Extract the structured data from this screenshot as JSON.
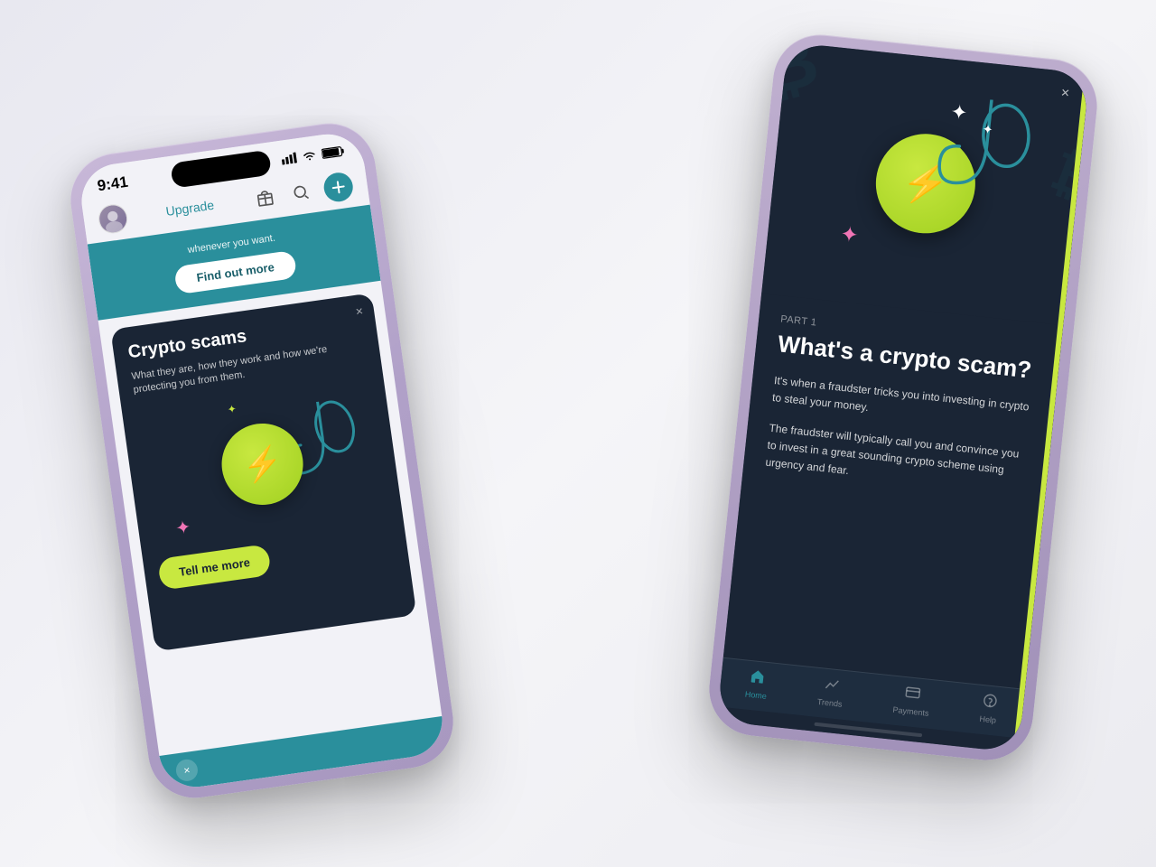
{
  "scene": {
    "background": "#f0f0f5"
  },
  "phone_left": {
    "status_bar": {
      "time": "9:41",
      "signal": "●●●●",
      "wifi": "WiFi",
      "battery": "🔋"
    },
    "nav": {
      "upgrade_label": "Upgrade"
    },
    "banner": {
      "text": "whenever you want.",
      "button_label": "Find out more"
    },
    "dark_card": {
      "close": "×",
      "title": "Crypto scams",
      "subtitle": "What they are, how they work and how we're protecting you from them.",
      "button_label": "Tell me more"
    }
  },
  "phone_right": {
    "close": "×",
    "article": {
      "part_label": "PART 1",
      "title": "What's a crypto scam?",
      "paragraph1": "It's when a fraudster tricks you into investing in crypto to steal your money.",
      "paragraph2": "The fraudster will typically call you and convince you to invest in a great sounding crypto scheme using urgency and fear."
    },
    "bottom_nav": {
      "items": [
        {
          "label": "Home",
          "active": true
        },
        {
          "label": "Trends",
          "active": false
        },
        {
          "label": "Payments",
          "active": false
        },
        {
          "label": "Help",
          "active": false
        }
      ]
    }
  }
}
